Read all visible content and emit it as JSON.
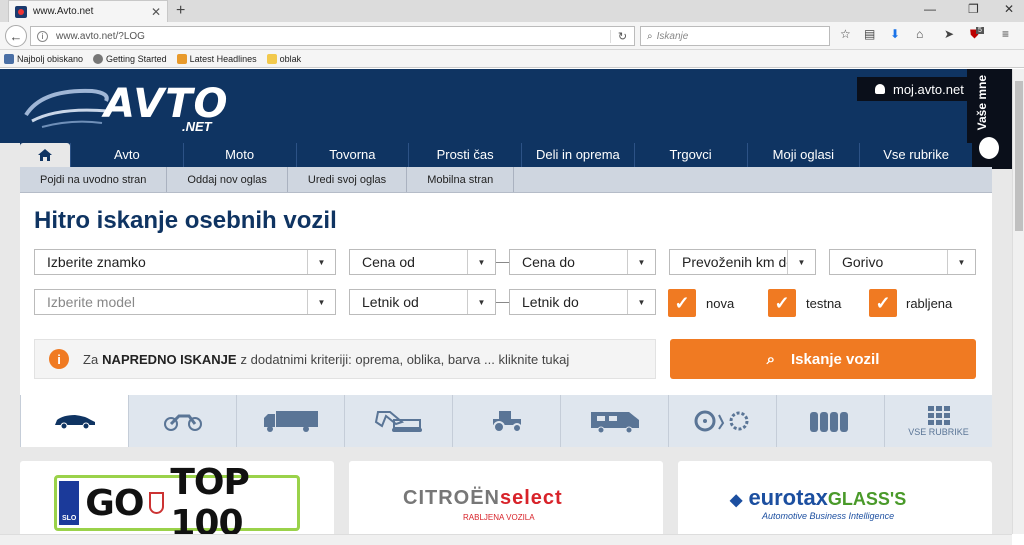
{
  "browser": {
    "tab_title": "www.Avto.net",
    "url": "www.avto.net/?LOG",
    "search_placeholder": "Iskanje",
    "badge_count": "5",
    "bookmarks": [
      "Najbolj obiskano",
      "Getting Started",
      "Latest Headlines",
      "oblak"
    ]
  },
  "header": {
    "logo_text": "AVTO",
    "logo_sub": ".NET",
    "account_label": "moj.avto.net",
    "side_label": "Vaše mne"
  },
  "main_nav": [
    "Avto",
    "Moto",
    "Tovorna",
    "Prosti čas",
    "Deli in oprema",
    "Trgovci",
    "Moji oglasi",
    "Vse rubrike"
  ],
  "sub_nav": [
    "Pojdi na uvodno stran",
    "Oddaj nov oglas",
    "Uredi svoj oglas",
    "Mobilna stran"
  ],
  "search": {
    "title": "Hitro iskanje osebnih vozil",
    "brand": "Izberite znamko",
    "model": "Izberite model",
    "price_from": "Cena od",
    "price_to": "Cena do",
    "year_from": "Letnik od",
    "year_to": "Letnik do",
    "km": "Prevoženih km do",
    "fuel": "Gorivo",
    "checkboxes": [
      {
        "label": "nova",
        "checked": true
      },
      {
        "label": "testna",
        "checked": true
      },
      {
        "label": "rabljena",
        "checked": true
      }
    ],
    "advanced_prefix": "Za",
    "advanced_bold": "NAPREDNO ISKANJE",
    "advanced_rest": "z dodatnimi kriteriji: oprema, oblika, barva ... kliknite tukaj",
    "button_label": "Iskanje vozil"
  },
  "categories": [
    "car-icon",
    "motorcycle-icon",
    "truck-icon",
    "excavator-icon",
    "tractor-icon",
    "camper-icon",
    "parts-icon",
    "tires-icon",
    "grid-icon"
  ],
  "categories_all_label": "VSE RUBRIKE",
  "banners": {
    "plate_left": "GO",
    "plate_right": "TOP 100",
    "plate_country": "SLO",
    "citroen_a": "CITROËN",
    "citroen_b": "select",
    "citroen_sub": "RABLJENA VOZILA",
    "eurotax_a": "eurotax",
    "eurotax_b": "GLASS'S",
    "eurotax_sub": "Automotive Business Intelligence"
  },
  "colors": {
    "brand_navy": "#0f3462",
    "accent_orange": "#f07a22"
  }
}
